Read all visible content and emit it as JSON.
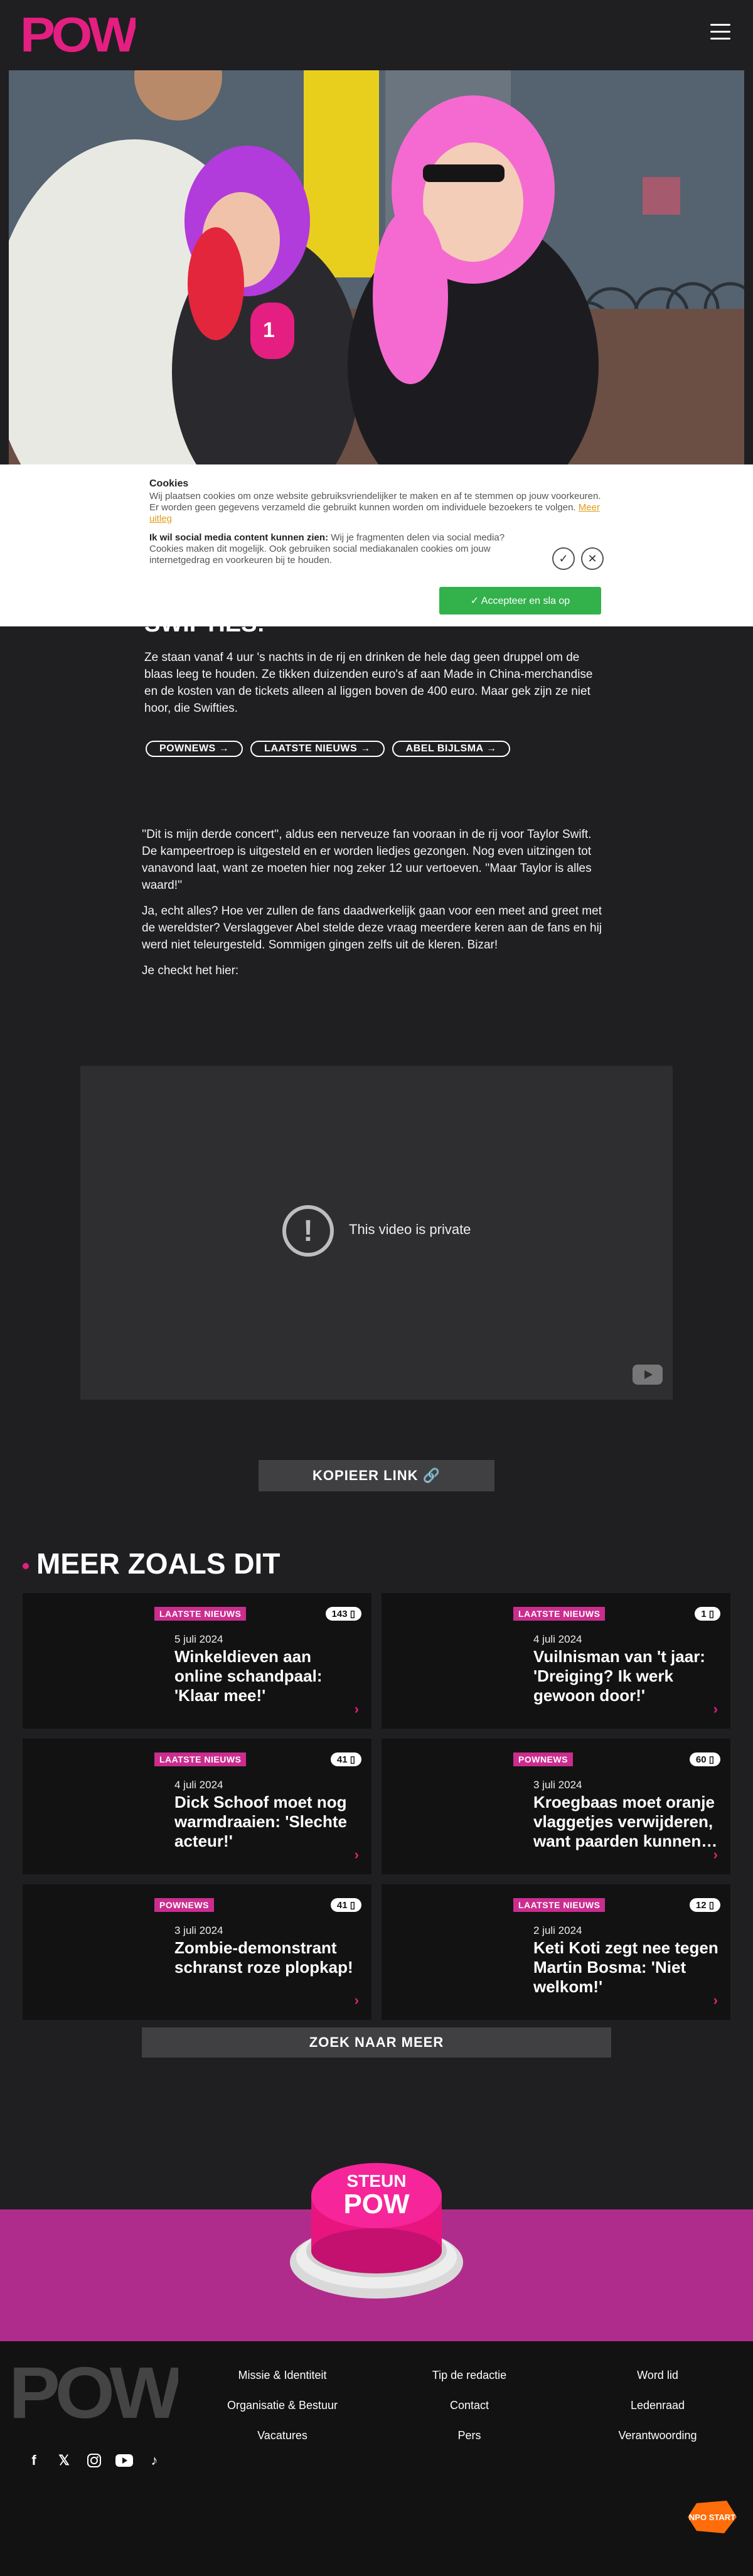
{
  "header": {
    "logo_text": "POW",
    "menu_icon": "hamburger-icon"
  },
  "cookie": {
    "title": "Cookies",
    "text": "Wij plaatsen cookies om onze website gebruiksvriendelijker te maken en af te stemmen op jouw voorkeuren. Er worden geen gegevens verzameld die gebruikt kunnen worden om individuele bezoekers te volgen. ",
    "more_link": "Meer uitleg",
    "social_bold": "Ik wil social media content kunnen zien:",
    "social_text": " Wij je fragmenten delen via social media? Cookies maken dit mogelijk. Ook gebruiken social mediakanalen cookies om jouw internetgedrag en voorkeuren bij te houden.",
    "accept_label": "✓ Accepteer en sla op"
  },
  "article": {
    "title_partial": "SWIFTIES!",
    "lead": "Ze staan vanaf 4 uur 's nachts in de rij en drinken de hele dag geen druppel om de blaas leeg te houden. Ze tikken duizenden euro's af aan Made in China-merchandise en de kosten van de tickets alleen al liggen boven de 400 euro. Maar gek zijn ze niet hoor, die Swifties.",
    "tags": [
      "POWNEWS →",
      "LAATSTE NIEUWS →",
      "ABEL BIJLSMA →"
    ],
    "p1": "''Dit is mijn derde concert'', aldus een nerveuze fan vooraan in de rij voor Taylor Swift. De kampeertroep is uitgesteld en er worden liedjes gezongen. Nog even uitzingen tot vanavond laat, want ze moeten hier nog zeker 12 uur vertoeven. ''Maar Taylor is alles waard!''",
    "p2": "Ja, echt alles? Hoe ver zullen de fans daadwerkelijk gaan voor een meet and greet met de wereldster? Verslaggever Abel stelde deze vraag meerdere keren aan de fans en hij werd niet teleurgesteld. Sommigen gingen zelfs uit de kleren. Bizar!",
    "p3": "Je checkt het hier:",
    "video_message": "This video is private",
    "copy_link": "KOPIEER LINK 🔗"
  },
  "more": {
    "heading": "MEER ZOALS DIT",
    "cards": [
      {
        "badge": "LAATSTE NIEUWS",
        "count": "143",
        "date": "5 juli 2024",
        "title": "Winkeldieven aan online schandpaal: 'Klaar mee!'"
      },
      {
        "badge": "LAATSTE NIEUWS",
        "count": "1",
        "date": "4 juli 2024",
        "title": "Vuilnisman van 't jaar: 'Dreiging? Ik werk gewoon door!'"
      },
      {
        "badge": "LAATSTE NIEUWS",
        "count": "41",
        "date": "4 juli 2024",
        "title": "Dick Schoof moet nog warmdraaien: 'Slechte acteur!'"
      },
      {
        "badge": "POWNEWS",
        "count": "60",
        "date": "3 juli 2024",
        "title": "Kroegbaas moet oranje vlaggetjes verwijderen, want paarden kunnen…"
      },
      {
        "badge": "POWNEWS",
        "count": "41",
        "date": "3 juli 2024",
        "title": "Zombie-demonstrant schranst roze plopkap!"
      },
      {
        "badge": "LAATSTE NIEUWS",
        "count": "12",
        "date": "2 juli 2024",
        "title": "Keti Koti zegt nee tegen Martin Bosma: 'Niet welkom!'"
      }
    ],
    "search_more": "ZOEK NAAR MEER"
  },
  "support": {
    "top": "STEUN",
    "bottom": "POW"
  },
  "footer": {
    "logo_text": "POW",
    "links": [
      "Missie & Identiteit",
      "Tip de redactie",
      "Word lid",
      "Organisatie & Bestuur",
      "Contact",
      "Ledenraad",
      "Vacatures",
      "Pers",
      "Verantwoording"
    ],
    "socials": [
      "facebook-icon",
      "x-icon",
      "instagram-icon",
      "youtube-icon",
      "tiktok-icon"
    ],
    "npo_text": "NPO START"
  },
  "colors": {
    "brand_pink": "#e51e81",
    "support_band": "#b02c8c",
    "accept_green": "#33b24b",
    "badge": "#cb2d8f"
  }
}
